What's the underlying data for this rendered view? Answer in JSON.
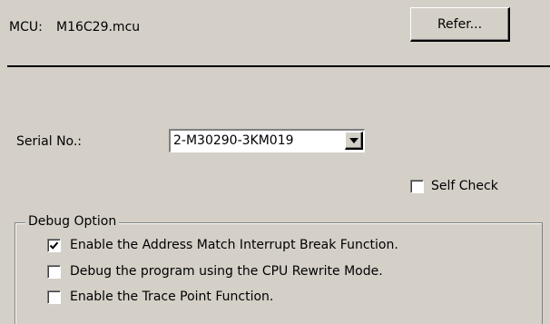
{
  "mcu": {
    "label": "MCU:",
    "value": "M16C29.mcu",
    "refer_label": "Refer..."
  },
  "serial": {
    "label": "Serial No.:",
    "selected": "2-M30290-3KM019"
  },
  "self_check": {
    "label": "Self Check",
    "checked": false
  },
  "debug_option": {
    "title": "Debug Option",
    "options": [
      {
        "label": "Enable the Address Match Interrupt Break Function.",
        "checked": true
      },
      {
        "label": "Debug the program using the CPU Rewrite Mode.",
        "checked": false
      },
      {
        "label": "Enable the Trace Point Function.",
        "checked": false
      }
    ]
  },
  "icons": {
    "dropdown": "chevron-down-icon",
    "check": "check-icon"
  }
}
